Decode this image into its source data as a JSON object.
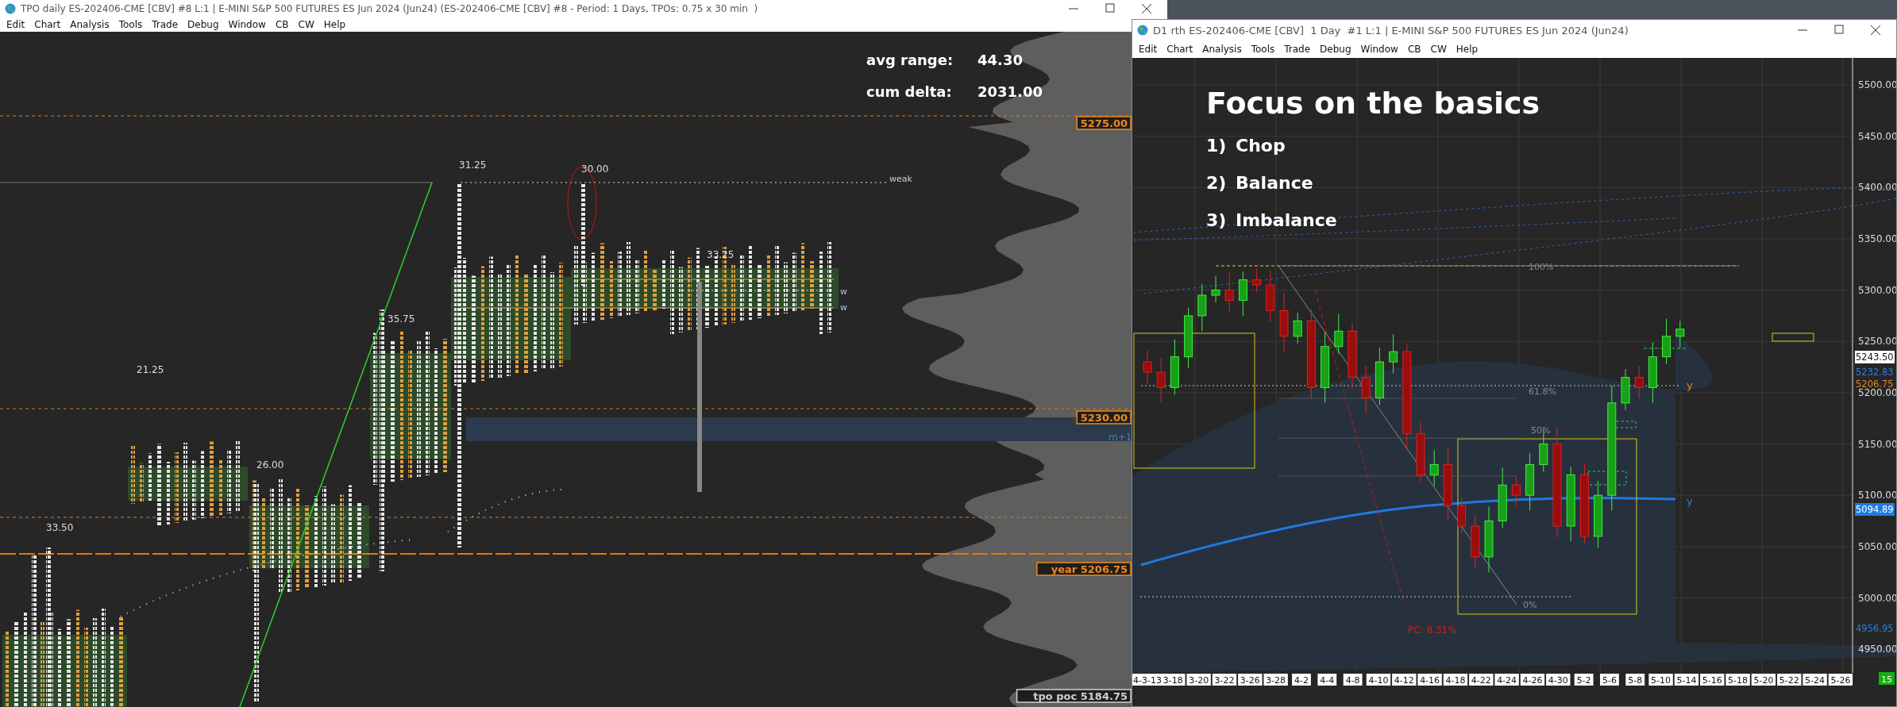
{
  "left_window": {
    "title": "TPO daily ES-202406-CME [CBV] #8 L:1 | E-MINI S&P 500 FUTURES ES Jun 2024 (Jun24) (ES-202406-CME [CBV] #8 - Period: 1 Days, TPOs: 0.75 x 30 min  )",
    "menu": [
      "Edit",
      "Chart",
      "Analysis",
      "Tools",
      "Trade",
      "Debug",
      "Window",
      "CB",
      "CW",
      "Help"
    ],
    "stats": [
      {
        "label": "avg range:",
        "value": "44.30"
      },
      {
        "label": "cum delta:",
        "value": "2031.00"
      }
    ],
    "range_labels": [
      "31.25",
      "30.00",
      "33.25",
      "35.75",
      "21.25",
      "26.00",
      "33.50"
    ],
    "markers": [
      "weak",
      "w",
      "w"
    ],
    "zone_label": "m+1",
    "level_tags": [
      {
        "price": "5275.00",
        "color": "#f08a1c"
      },
      {
        "price": "5230.00",
        "color": "#f08a1c"
      },
      {
        "label": "year",
        "price": "5206.75",
        "color": "#f08a1c"
      },
      {
        "label": "tpo poc",
        "price": "5184.75",
        "color": "#d0d0d0"
      }
    ]
  },
  "right_window": {
    "title": "D1 rth ES-202406-CME [CBV]  1 Day  #1 L:1 | E-MINI S&P 500 FUTURES ES Jun 2024 (Jun24)",
    "menu": [
      "Edit",
      "Chart",
      "Analysis",
      "Tools",
      "Trade",
      "Debug",
      "Window",
      "CB",
      "CW",
      "Help"
    ],
    "headline": "Focus on the basics",
    "points": [
      {
        "number": "1)",
        "text": "Chop"
      },
      {
        "number": "2)",
        "text": "Balance"
      },
      {
        "number": "3)",
        "text": "Imbalance"
      }
    ],
    "fib_labels": [
      "100%",
      "61.8%",
      "50%",
      "0%"
    ],
    "pc_label": "PC: 8.31%",
    "y_labels": [
      {
        "text": "y",
        "color": "#e08a1c"
      },
      {
        "text": "y",
        "color": "#2a7de0"
      }
    ],
    "price_axis": [
      "5500.00",
      "5450.00",
      "5400.00",
      "5350.00",
      "5300.00",
      "5250.00",
      "5200.00",
      "5150.00",
      "5100.00",
      "5050.00",
      "5000.00",
      "4950.00"
    ],
    "price_tags": [
      {
        "text": "5243.50",
        "kind": "filled",
        "color": "#ffffff"
      },
      {
        "text": "5232.83",
        "kind": "plain",
        "color": "#2a7de0"
      },
      {
        "text": "5206.75",
        "kind": "plain",
        "color": "#e08a1c"
      },
      {
        "text": "5094.89",
        "kind": "filled",
        "color": "#1e7be0"
      },
      {
        "text": "4956.95",
        "kind": "plain",
        "color": "#2a7de0"
      }
    ],
    "date_axis": [
      "4-3-13",
      "3-18",
      "3-20",
      "3-22",
      "3-26",
      "3-28",
      "4-2",
      "4-4",
      "4-8",
      "4-10",
      "4-12",
      "4-16",
      "4-18",
      "4-22",
      "4-24",
      "4-26",
      "4-30",
      "5-2",
      "5-6",
      "5-8",
      "5-10",
      "5-14",
      "5-16",
      "5-18",
      "5-20",
      "5-22",
      "5-24",
      "5-26"
    ],
    "bar_count": "15"
  }
}
